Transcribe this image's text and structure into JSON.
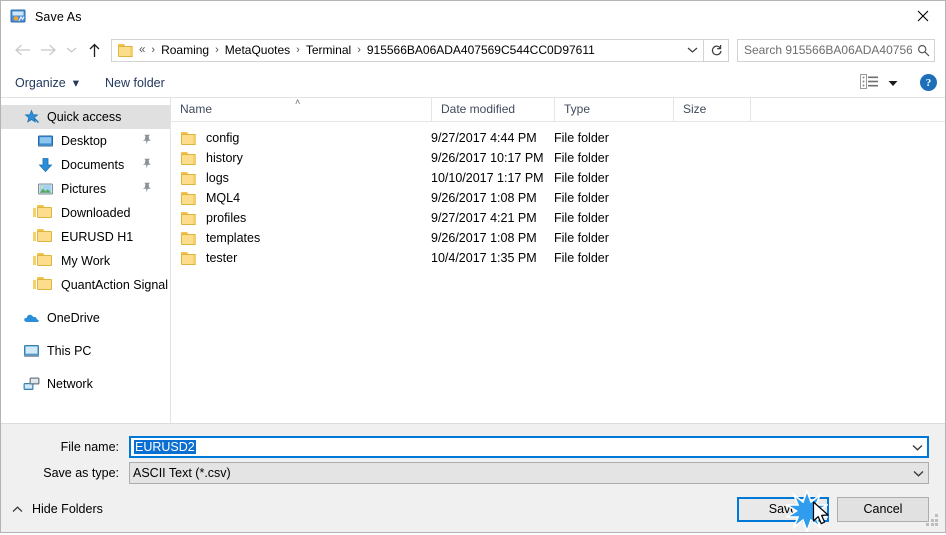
{
  "window": {
    "title": "Save As",
    "icon": "metatrader-save-icon",
    "close_label": "✕"
  },
  "nav": {
    "back_icon": "arrow-left-icon",
    "forward_icon": "arrow-right-icon",
    "recent_icon": "chevron-down-icon",
    "up_icon": "arrow-up-icon",
    "folder_icon": "folder-icon",
    "overflow": "«",
    "breadcrumbs": [
      "Roaming",
      "MetaQuotes",
      "Terminal",
      "915566BA06ADA407569C544CC0D97611"
    ],
    "separator": "›",
    "dropdown_icon": "chevron-down-icon",
    "refresh_icon": "refresh-icon"
  },
  "search": {
    "placeholder": "Search 915566BA06ADA40756...",
    "icon": "search-icon"
  },
  "commandbar": {
    "organize_label": "Organize",
    "organize_caret": "▾",
    "new_folder_label": "New folder",
    "view_icon": "view-layout-icon",
    "view_caret": "▾",
    "help_label": "?"
  },
  "sidebar": {
    "items": [
      {
        "label": "Quick access",
        "icon": "star-pin-icon",
        "selected": true,
        "indent": false,
        "pinned": false,
        "gap_before": false
      },
      {
        "label": "Desktop",
        "icon": "desktop-icon",
        "selected": false,
        "indent": true,
        "pinned": true,
        "gap_before": false
      },
      {
        "label": "Documents",
        "icon": "documents-download-icon",
        "selected": false,
        "indent": true,
        "pinned": true,
        "gap_before": false
      },
      {
        "label": "Pictures",
        "icon": "pictures-icon",
        "selected": false,
        "indent": true,
        "pinned": true,
        "gap_before": false
      },
      {
        "label": "Downloaded",
        "icon": "folder-icon",
        "selected": false,
        "indent": true,
        "pinned": false,
        "gap_before": false
      },
      {
        "label": "EURUSD H1",
        "icon": "folder-icon",
        "selected": false,
        "indent": true,
        "pinned": false,
        "gap_before": false
      },
      {
        "label": "My Work",
        "icon": "folder-icon",
        "selected": false,
        "indent": true,
        "pinned": false,
        "gap_before": false
      },
      {
        "label": "QuantAction Signal",
        "icon": "folder-icon",
        "selected": false,
        "indent": true,
        "pinned": false,
        "gap_before": false
      },
      {
        "label": "OneDrive",
        "icon": "onedrive-cloud-icon",
        "selected": false,
        "indent": false,
        "pinned": false,
        "gap_before": true
      },
      {
        "label": "This PC",
        "icon": "this-pc-monitor-icon",
        "selected": false,
        "indent": false,
        "pinned": false,
        "gap_before": true
      },
      {
        "label": "Network",
        "icon": "network-icon",
        "selected": false,
        "indent": false,
        "pinned": false,
        "gap_before": true
      }
    ]
  },
  "filelist": {
    "columns": [
      "Name",
      "Date modified",
      "Type",
      "Size"
    ],
    "sort_column": "Name",
    "sort_indicator": "˄",
    "rows": [
      {
        "name": "config",
        "date": "9/27/2017 4:44 PM",
        "type": "File folder",
        "size": "",
        "icon": "folder-icon"
      },
      {
        "name": "history",
        "date": "9/26/2017 10:17 PM",
        "type": "File folder",
        "size": "",
        "icon": "folder-icon"
      },
      {
        "name": "logs",
        "date": "10/10/2017 1:17 PM",
        "type": "File folder",
        "size": "",
        "icon": "folder-icon"
      },
      {
        "name": "MQL4",
        "date": "9/26/2017 1:08 PM",
        "type": "File folder",
        "size": "",
        "icon": "folder-icon"
      },
      {
        "name": "profiles",
        "date": "9/27/2017 4:21 PM",
        "type": "File folder",
        "size": "",
        "icon": "folder-icon"
      },
      {
        "name": "templates",
        "date": "9/26/2017 1:08 PM",
        "type": "File folder",
        "size": "",
        "icon": "folder-icon"
      },
      {
        "name": "tester",
        "date": "10/4/2017 1:35 PM",
        "type": "File folder",
        "size": "",
        "icon": "folder-icon"
      }
    ]
  },
  "form": {
    "filename_label": "File name:",
    "filename_value": "EURUSD2",
    "filename_selected": true,
    "savetype_label": "Save as type:",
    "savetype_value": "ASCII Text (*.csv)",
    "dropdown_icon": "chevron-down-icon"
  },
  "footer": {
    "hide_folders_label": "Hide Folders",
    "hide_folders_icon": "chevron-up-icon",
    "save_label": "Save",
    "cancel_label": "Cancel",
    "resize_grip_icon": "resize-grip-icon"
  },
  "colors": {
    "accent": "#0078d7",
    "selection": "#0a6fd0",
    "sidebar_selected": "#e0e0e0",
    "chrome": "#f0f0f0",
    "command_text": "#23395d",
    "folder_yellow": "#fcdd8b"
  }
}
